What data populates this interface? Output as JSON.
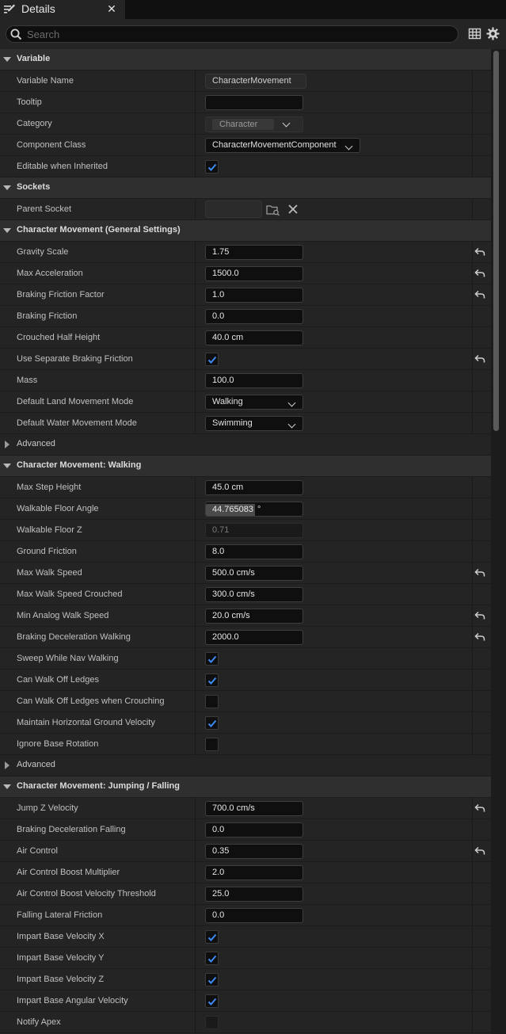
{
  "tab": {
    "label": "Details",
    "close": "✕"
  },
  "search": {
    "placeholder": "Search",
    "value": ""
  },
  "rows": [
    {
      "kind": "category",
      "label": "Variable"
    },
    {
      "kind": "text",
      "name": "Variable Name",
      "value": "CharacterMovement",
      "style": "named"
    },
    {
      "kind": "text",
      "name": "Tooltip",
      "value": ""
    },
    {
      "kind": "catbox",
      "name": "Category",
      "value": "Character"
    },
    {
      "kind": "combo",
      "name": "Component Class",
      "value": "CharacterMovementComponent",
      "width": 196
    },
    {
      "kind": "check",
      "name": "Editable when Inherited",
      "checked": true
    },
    {
      "kind": "category",
      "label": "Sockets"
    },
    {
      "kind": "socket",
      "name": "Parent Socket",
      "value": ""
    },
    {
      "kind": "category",
      "label": "Character Movement (General Settings)"
    },
    {
      "kind": "text",
      "name": "Gravity Scale",
      "value": "1.75",
      "reset": true
    },
    {
      "kind": "text",
      "name": "Max Acceleration",
      "value": "1500.0",
      "reset": true
    },
    {
      "kind": "text",
      "name": "Braking Friction Factor",
      "value": "1.0",
      "reset": true
    },
    {
      "kind": "text",
      "name": "Braking Friction",
      "value": "0.0"
    },
    {
      "kind": "text",
      "name": "Crouched Half Height",
      "value": "40.0 cm"
    },
    {
      "kind": "check",
      "name": "Use Separate Braking Friction",
      "checked": true,
      "reset": true
    },
    {
      "kind": "text",
      "name": "Mass",
      "value": "100.0"
    },
    {
      "kind": "combo",
      "name": "Default Land Movement Mode",
      "value": "Walking",
      "width": 124
    },
    {
      "kind": "combo",
      "name": "Default Water Movement Mode",
      "value": "Swimming",
      "width": 124
    },
    {
      "kind": "advanced",
      "label": "Advanced"
    },
    {
      "kind": "category",
      "label": "Character Movement: Walking"
    },
    {
      "kind": "text",
      "name": "Max Step Height",
      "value": "45.0 cm"
    },
    {
      "kind": "angle",
      "name": "Walkable Floor Angle",
      "value": "44.765083",
      "unit": "°"
    },
    {
      "kind": "text",
      "name": "Walkable Floor Z",
      "value": "0.71",
      "style": "ro"
    },
    {
      "kind": "text",
      "name": "Ground Friction",
      "value": "8.0"
    },
    {
      "kind": "text",
      "name": "Max Walk Speed",
      "value": "500.0 cm/s",
      "reset": true
    },
    {
      "kind": "text",
      "name": "Max Walk Speed Crouched",
      "value": "300.0 cm/s"
    },
    {
      "kind": "text",
      "name": "Min Analog Walk Speed",
      "value": "20.0 cm/s",
      "reset": true
    },
    {
      "kind": "text",
      "name": "Braking Deceleration Walking",
      "value": "2000.0",
      "reset": true
    },
    {
      "kind": "check",
      "name": "Sweep While Nav Walking",
      "checked": true
    },
    {
      "kind": "check",
      "name": "Can Walk Off Ledges",
      "checked": true
    },
    {
      "kind": "check",
      "name": "Can Walk Off Ledges when Crouching",
      "checked": false
    },
    {
      "kind": "check",
      "name": "Maintain Horizontal Ground Velocity",
      "checked": true
    },
    {
      "kind": "check",
      "name": "Ignore Base Rotation",
      "checked": false
    },
    {
      "kind": "advanced",
      "label": "Advanced"
    },
    {
      "kind": "category",
      "label": "Character Movement: Jumping / Falling"
    },
    {
      "kind": "text",
      "name": "Jump Z Velocity",
      "value": "700.0 cm/s",
      "reset": true
    },
    {
      "kind": "text",
      "name": "Braking Deceleration Falling",
      "value": "0.0"
    },
    {
      "kind": "text",
      "name": "Air Control",
      "value": "0.35",
      "reset": true
    },
    {
      "kind": "text",
      "name": "Air Control Boost Multiplier",
      "value": "2.0"
    },
    {
      "kind": "text",
      "name": "Air Control Boost Velocity Threshold",
      "value": "25.0"
    },
    {
      "kind": "text",
      "name": "Falling Lateral Friction",
      "value": "0.0"
    },
    {
      "kind": "check",
      "name": "Impart Base Velocity X",
      "checked": true
    },
    {
      "kind": "check",
      "name": "Impart Base Velocity Y",
      "checked": true
    },
    {
      "kind": "check",
      "name": "Impart Base Velocity Z",
      "checked": true
    },
    {
      "kind": "check",
      "name": "Impart Base Angular Velocity",
      "checked": true
    },
    {
      "kind": "check",
      "name": "Notify Apex",
      "checked": false,
      "style": "dim"
    }
  ]
}
